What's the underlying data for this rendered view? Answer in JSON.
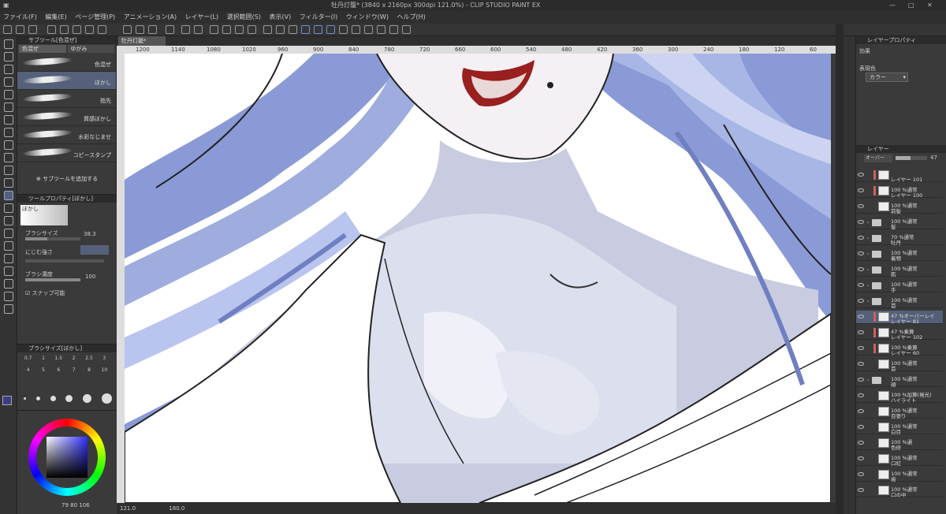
{
  "app": {
    "title": "牡丹灯籠* (3840 x 2160px 300dpi 121.0%) - CLIP STUDIO PAINT EX"
  },
  "menu": [
    "ファイル(F)",
    "編集(E)",
    "ページ管理(P)",
    "アニメーション(A)",
    "レイヤー(L)",
    "選択範囲(S)",
    "表示(V)",
    "フィルター(I)",
    "ウィンドウ(W)",
    "ヘルプ(H)"
  ],
  "subtool": {
    "panel_title": "サブツール[色混ぜ]",
    "tabs": [
      "色混ぜ",
      "ゆがみ"
    ],
    "brushes": [
      "色混ぜ",
      "ぼかし",
      "指先",
      "質感ぼかし",
      "水彩なじませ",
      "コピースタンプ"
    ],
    "selected_index": 1,
    "add_label": "サブツールを追加する"
  },
  "toolprop": {
    "panel_title": "ツールプロパティ[ぼかし]",
    "selected_name": "ぼかし",
    "brush_size_label": "ブラシサイズ",
    "brush_size_value": "38.3",
    "blur_strength_label": "にじむ強さ",
    "brush_density_label": "ブラシ濃度",
    "brush_density_value": "100",
    "snap_label": "スナップ可能"
  },
  "brushsize_panel": {
    "title": "ブラシサイズ[ぼかし]",
    "presets": [
      "0.7",
      "1",
      "1.5",
      "2",
      "2.5",
      "3",
      "4",
      "5",
      "6",
      "7",
      "8",
      "10"
    ]
  },
  "color": {
    "values": [
      "79",
      "80",
      "106"
    ],
    "main": "#3c3c86"
  },
  "canvas": {
    "doc_tab": "牡丹灯籠*",
    "ruler_ticks": [
      "1200",
      "1140",
      "1080",
      "1020",
      "960",
      "900",
      "840",
      "780",
      "720",
      "660",
      "600",
      "540",
      "480",
      "420",
      "360",
      "300",
      "240",
      "180",
      "120",
      "60"
    ],
    "zoom": "121.0",
    "angle": "180.0"
  },
  "layer_property": {
    "panel_title": "レイヤープロパティ",
    "effect_label": "効果",
    "display_color_label": "表現色",
    "display_color_value": "カラー"
  },
  "layer_panel": {
    "panel_title": "レイヤー",
    "blend_mode": "オーバー",
    "opacity": "47",
    "layers": [
      {
        "l1": "",
        "l2": "レイヤー 101",
        "kind": "layer",
        "mark": true
      },
      {
        "l1": "100 %通常",
        "l2": "レイヤー 100",
        "kind": "layer",
        "mark": true
      },
      {
        "l1": "100 %通常",
        "l2": "前髪",
        "kind": "layer",
        "mark": false
      },
      {
        "l1": "100 %通常",
        "l2": "髪",
        "kind": "folder",
        "mark": false
      },
      {
        "l1": "70 %通常",
        "l2": "牡丹",
        "kind": "folder",
        "mark": false
      },
      {
        "l1": "100 %通常",
        "l2": "着物",
        "kind": "folder",
        "mark": false
      },
      {
        "l1": "100 %通常",
        "l2": "肌",
        "kind": "folder",
        "mark": false
      },
      {
        "l1": "100 %通常",
        "l2": "手",
        "kind": "folder",
        "mark": false
      },
      {
        "l1": "100 %通常",
        "l2": "首",
        "kind": "folder",
        "mark": false
      },
      {
        "l1": "47 %オーバーレイ",
        "l2": "レイヤー 81",
        "kind": "layer",
        "mark": true,
        "selected": true
      },
      {
        "l1": "47 %乗算",
        "l2": "レイヤー 102",
        "kind": "layer",
        "mark": true
      },
      {
        "l1": "100 %乗算",
        "l2": "レイヤー 60",
        "kind": "layer",
        "mark": true
      },
      {
        "l1": "100 %通常",
        "l2": "首",
        "kind": "layer",
        "mark": false
      },
      {
        "l1": "100 %通常",
        "l2": "顔",
        "kind": "folder",
        "mark": false
      },
      {
        "l1": "100 %加算(発光)",
        "l2": "ハイライト",
        "kind": "layer",
        "mark": false
      },
      {
        "l1": "100 %通常",
        "l2": "目張り",
        "kind": "layer",
        "mark": false
      },
      {
        "l1": "100 %通常",
        "l2": "白目",
        "kind": "layer",
        "mark": false
      },
      {
        "l1": "100 %通",
        "l2": "色修",
        "kind": "layer",
        "mark": false
      },
      {
        "l1": "100 %通常",
        "l2": "口紅",
        "kind": "layer",
        "mark": false
      },
      {
        "l1": "100 %通常",
        "l2": "歯",
        "kind": "layer",
        "mark": false
      },
      {
        "l1": "100 %通常",
        "l2": "口の中",
        "kind": "layer",
        "mark": false
      }
    ]
  }
}
